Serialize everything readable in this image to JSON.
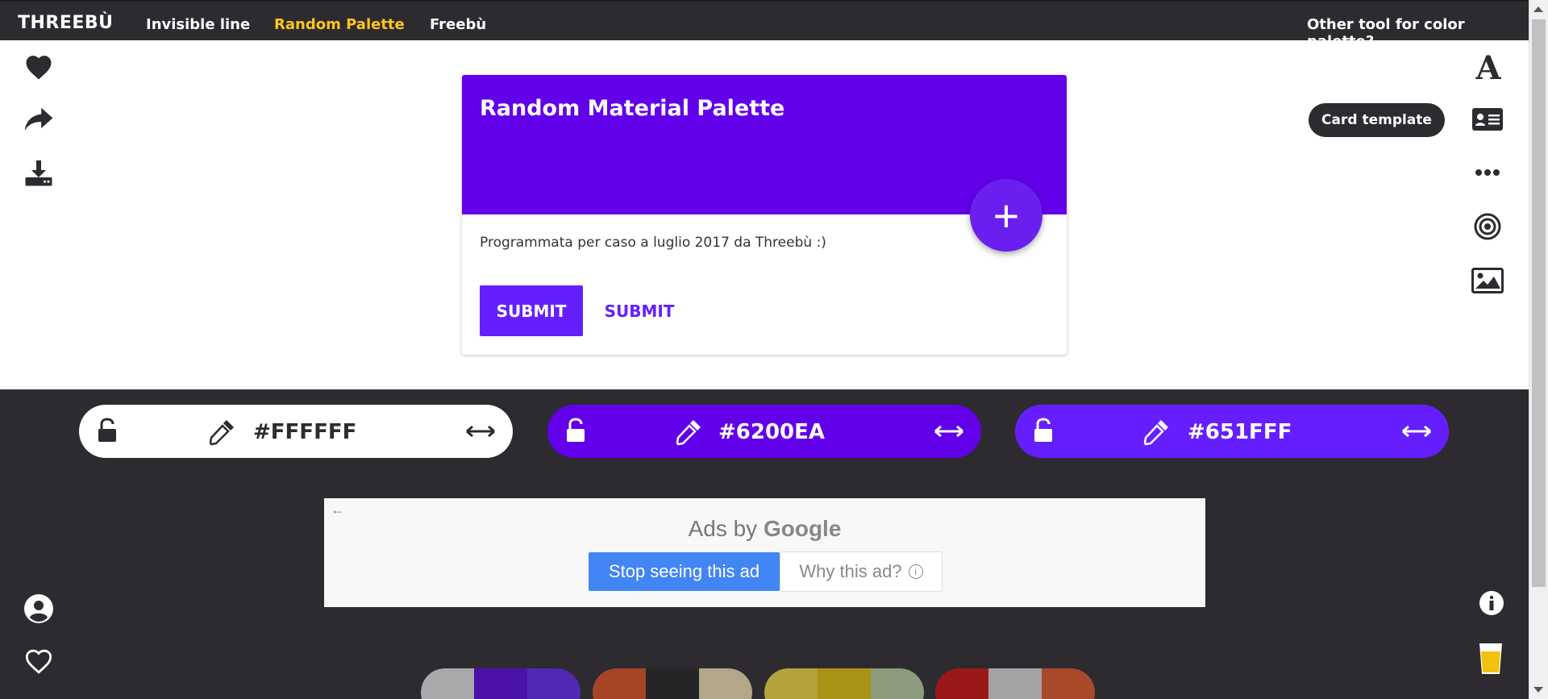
{
  "nav": {
    "logo": "THREEBÙ",
    "links": [
      "Invisible line",
      "Random Palette",
      "Freebù"
    ],
    "other_tool": "Other tool for color palette?"
  },
  "card": {
    "title": "Random Material Palette",
    "text": "Programmata per caso a luglio 2017 da Threebù :)",
    "fab_symbol": "+",
    "submit_solid": "SUBMIT",
    "submit_text": "SUBMIT"
  },
  "card_template_label": "Card template",
  "colors": {
    "primary": "#6200EA",
    "accent": "#651FFF",
    "dark": "#2D2B30",
    "nav_active": "#FFC61A"
  },
  "pills": [
    {
      "hex": "#FFFFFF",
      "bg": "#FFFFFF",
      "fg": "#2d2b30"
    },
    {
      "hex": "#6200EA",
      "bg": "#6200EA",
      "fg": "#FFFFFF"
    },
    {
      "hex": "#651FFF",
      "bg": "#651FFF",
      "fg": "#FFFFFF"
    }
  ],
  "ad": {
    "ads_by": "Ads by",
    "google": "Google",
    "stop": "Stop seeing this ad",
    "why": "Why this ad?"
  },
  "left_icons": [
    "heart-icon",
    "share-icon",
    "download-icon"
  ],
  "right_icons": [
    "font-icon",
    "card-icon",
    "more-icon",
    "target-icon",
    "image-icon"
  ],
  "bottom_left_icons": [
    "user-icon",
    "heart-outline-icon"
  ],
  "bottom_right_icons": [
    "info-icon",
    "beer-icon"
  ],
  "palettes": [
    [
      "#A9A9AB",
      "#4A12A8",
      "#5128B3"
    ],
    [
      "#A64526",
      "#252525",
      "#B3A689"
    ],
    [
      "#B2A43A",
      "#AA9217",
      "#8C9B7B"
    ],
    [
      "#9A1818",
      "#A3A3A5",
      "#A84A2A"
    ]
  ]
}
